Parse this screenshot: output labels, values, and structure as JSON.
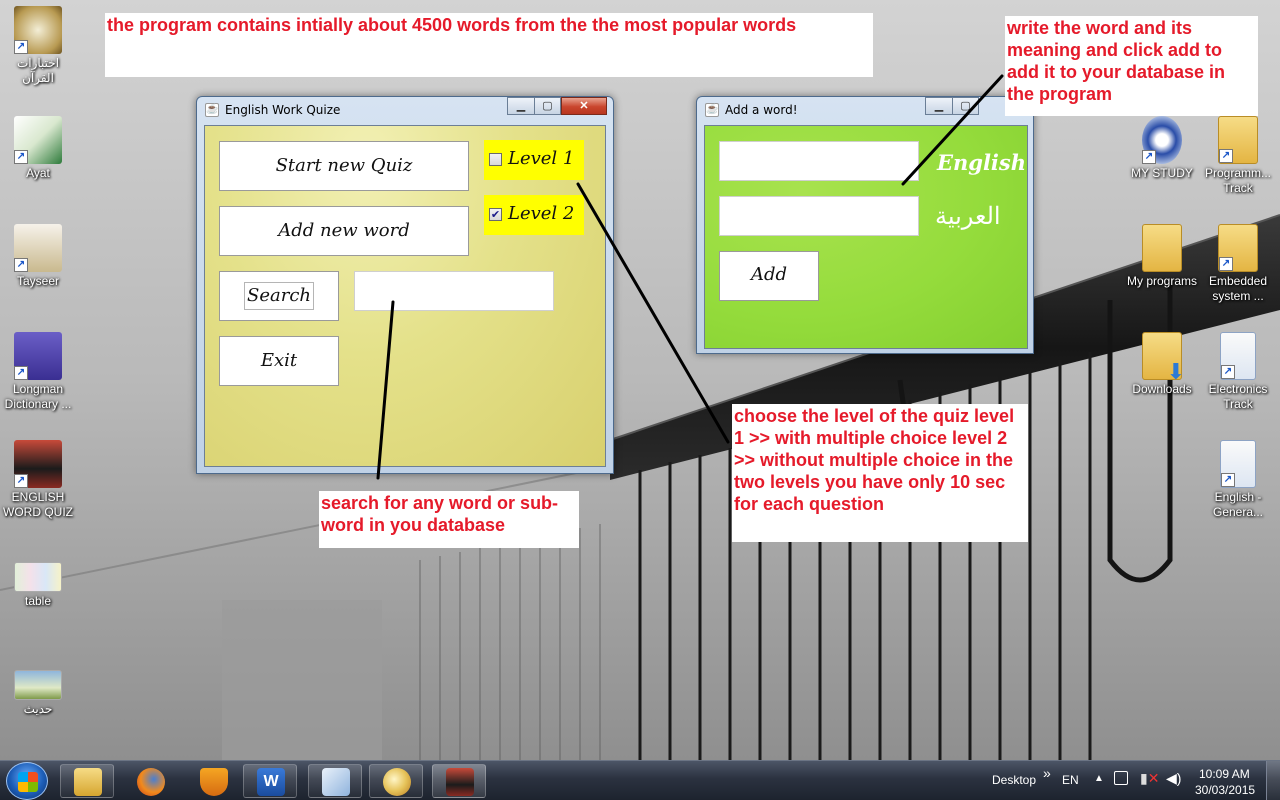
{
  "annotations": {
    "top": "the program contains intially about 4500 words from the the most popular words",
    "add_word": "write the word and its meaning and click add to add it to your database in the program",
    "levels": "choose the level of the quiz level 1 >> with multiple choice level 2 >> without multiple choice in the two levels you have only 10 sec for each question",
    "search": "search for any word or sub-word in you database"
  },
  "main_window": {
    "title": "English Work Quize",
    "start_button": "Start new Quiz",
    "add_button": "Add new word",
    "search_button": "Search",
    "exit_button": "Exit",
    "search_value": "",
    "level1": {
      "label": "Level 1",
      "checked": false
    },
    "level2": {
      "label": "Level 2",
      "checked": true
    }
  },
  "add_window": {
    "title": "Add a word!",
    "english_label": "English",
    "arabic_label": "العربية",
    "english_value": "",
    "arabic_value": "",
    "add_button": "Add"
  },
  "desktop_left": [
    {
      "label": "اختبارات القرآن",
      "icon": "quran-icon"
    },
    {
      "label": "Ayat",
      "icon": "ayat-icon"
    },
    {
      "label": "Tayseer",
      "icon": "tayseer-icon"
    },
    {
      "label": "Longman Dictionary ...",
      "icon": "longman-icon"
    },
    {
      "label": "ENGLISH WORD QUIZ",
      "icon": "english-quiz-icon"
    },
    {
      "label": "table",
      "icon": "table-icon"
    },
    {
      "label": "حديث",
      "icon": "hadith-icon"
    }
  ],
  "desktop_right": [
    {
      "label": "MY STUDY"
    },
    {
      "label": "Programm... Track"
    },
    {
      "label": "My programs"
    },
    {
      "label": "Embedded system ..."
    },
    {
      "label": "Downloads"
    },
    {
      "label": "Electronics Track"
    },
    {
      "label": "English - Genera..."
    }
  ],
  "taskbar": {
    "desktop_label": "Desktop",
    "chevron": "»",
    "language": "EN",
    "time": "10:09 AM",
    "date": "30/03/2015"
  },
  "colors": {
    "annotation_text": "#e51a2a",
    "main_client_bg": "#e4e18a",
    "add_client_bg": "#95dc3c",
    "level_bg": "#ffff00"
  }
}
